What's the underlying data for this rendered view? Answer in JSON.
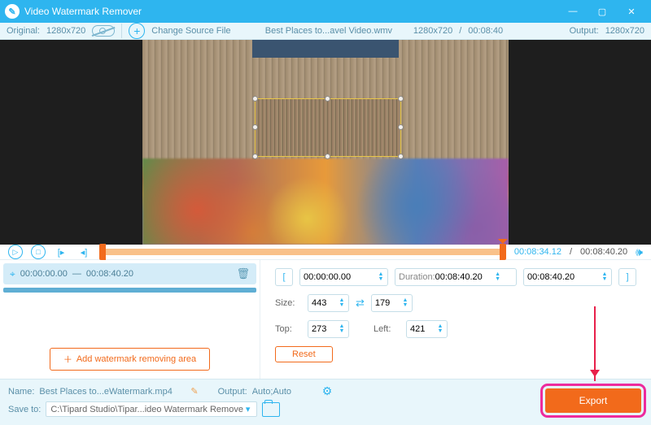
{
  "titlebar": {
    "app_title": "Video Watermark Remover"
  },
  "toolbar": {
    "original_label": "Original:",
    "original_res": "1280x720",
    "change_source": "Change Source File",
    "filename": "Best Places to...avel Video.wmv",
    "src_res": "1280x720",
    "src_dur": "00:08:40",
    "output_label": "Output:",
    "output_res": "1280x720"
  },
  "transport": {
    "current_time": "00:08:34.12",
    "total_time": "00:08:40.20"
  },
  "segment": {
    "start": "00:00:00.00",
    "sep": "—",
    "end": "00:08:40.20"
  },
  "add_area_label": "Add watermark removing area",
  "range": {
    "start": "00:00:00.00",
    "duration_label": "Duration:",
    "duration": "00:08:40.20",
    "end": "00:08:40.20"
  },
  "size": {
    "label": "Size:",
    "w": "443",
    "h": "179"
  },
  "pos": {
    "top_label": "Top:",
    "top": "273",
    "left_label": "Left:",
    "left": "421"
  },
  "reset_label": "Reset",
  "bottom": {
    "name_label": "Name:",
    "name_value": "Best Places to...eWatermark.mp4",
    "output_label": "Output:",
    "output_value": "Auto;Auto",
    "save_label": "Save to:",
    "save_path": "C:\\Tipard Studio\\Tipar...ideo Watermark Remover",
    "export_label": "Export"
  }
}
